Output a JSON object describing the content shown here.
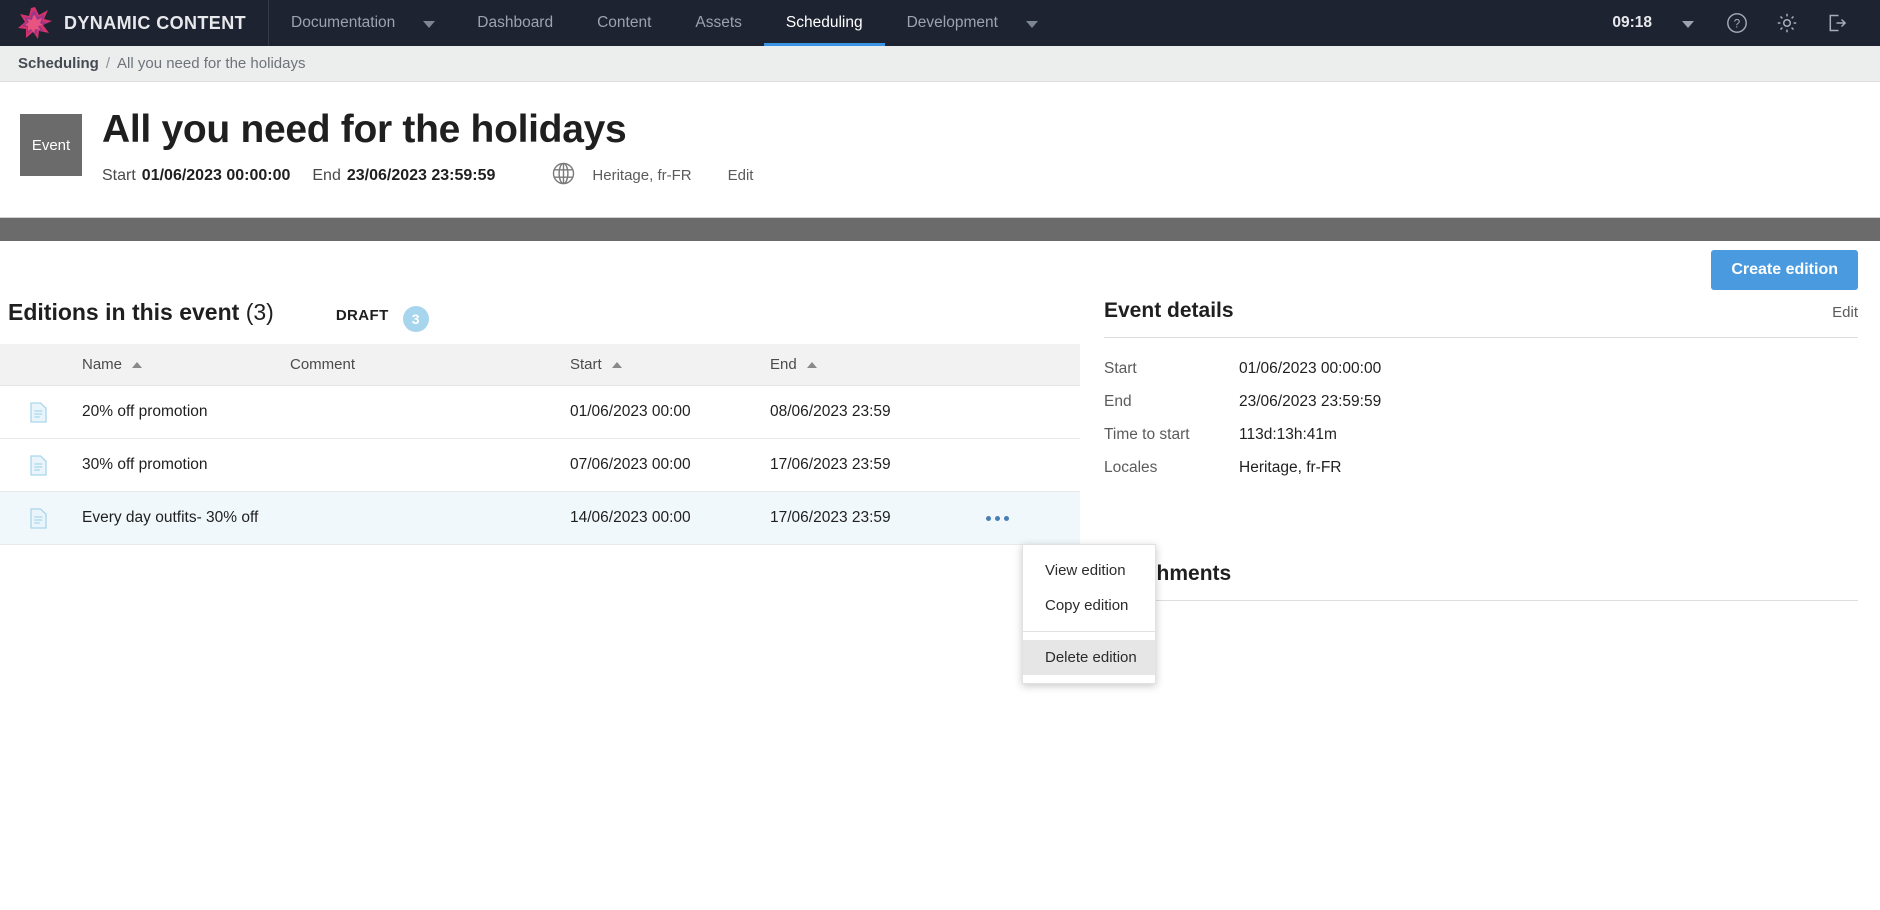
{
  "topnav": {
    "brand": "DYNAMIC CONTENT",
    "brand_logo_icon": "star-burst-logo-icon",
    "items": [
      {
        "label": "Documentation",
        "has_caret": true,
        "active": false
      },
      {
        "label": "Dashboard",
        "has_caret": false,
        "active": false
      },
      {
        "label": "Content",
        "has_caret": false,
        "active": false
      },
      {
        "label": "Assets",
        "has_caret": false,
        "active": false
      },
      {
        "label": "Scheduling",
        "has_caret": false,
        "active": true
      },
      {
        "label": "Development",
        "has_caret": true,
        "active": false
      }
    ],
    "clock": "09:18",
    "right_icons": [
      "chevron-down-icon",
      "help-icon",
      "gear-icon",
      "logout-icon"
    ],
    "active_underline_color": "#3b93e3",
    "background_color": "#1d2330"
  },
  "breadcrumb": {
    "root": "Scheduling",
    "separator": "/",
    "current": "All you need for the holidays"
  },
  "event_header": {
    "chip_label": "Event",
    "title": "All you need for the holidays",
    "start_label": "Start",
    "start_value": "01/06/2023 00:00:00",
    "end_label": "End",
    "end_value": "23/06/2023 23:59:59",
    "globe_icon": "globe-icon",
    "locales": "Heritage, fr-FR",
    "edit_label": "Edit"
  },
  "action_bar": {
    "create_edition_label": "Create edition",
    "accent_color": "#4a9ae0"
  },
  "editions": {
    "heading_bold": "Editions in this event",
    "heading_count": "(3)",
    "draft_label": "DRAFT",
    "draft_count": "3",
    "draft_badge_color": "#a8d5ee",
    "columns": [
      {
        "label": "Name",
        "sort": "asc"
      },
      {
        "label": "Comment",
        "sort": "none"
      },
      {
        "label": "Start",
        "sort": "asc"
      },
      {
        "label": "End",
        "sort": "asc"
      },
      {
        "label": "",
        "sort": "none"
      }
    ],
    "rows": [
      {
        "icon": "document-icon",
        "name": "20% off promotion",
        "comment": "",
        "start": "01/06/2023 00:00",
        "end": "08/06/2023 23:59",
        "selected": false
      },
      {
        "icon": "document-icon",
        "name": "30% off promotion",
        "comment": "",
        "start": "07/06/2023 00:00",
        "end": "17/06/2023 23:59",
        "selected": false
      },
      {
        "icon": "document-icon",
        "name": "Every day outfits- 30% off",
        "comment": "",
        "start": "14/06/2023 00:00",
        "end": "17/06/2023 23:59",
        "selected": true
      }
    ]
  },
  "context_menu": {
    "items": [
      {
        "label": "View edition",
        "hover": false
      },
      {
        "label": "Copy edition",
        "hover": false
      },
      {
        "label": "Delete edition",
        "hover": true
      }
    ]
  },
  "event_details": {
    "title": "Event details",
    "edit_label": "Edit",
    "rows": [
      {
        "key": "Start",
        "value": "01/06/2023 00:00:00"
      },
      {
        "key": "End",
        "value": "23/06/2023 23:59:59"
      },
      {
        "key": "Time to start",
        "value": "113d:13h:41m"
      },
      {
        "key": "Locales",
        "value": "Heritage, fr-FR"
      }
    ]
  },
  "attachments": {
    "title": "Attachments"
  }
}
